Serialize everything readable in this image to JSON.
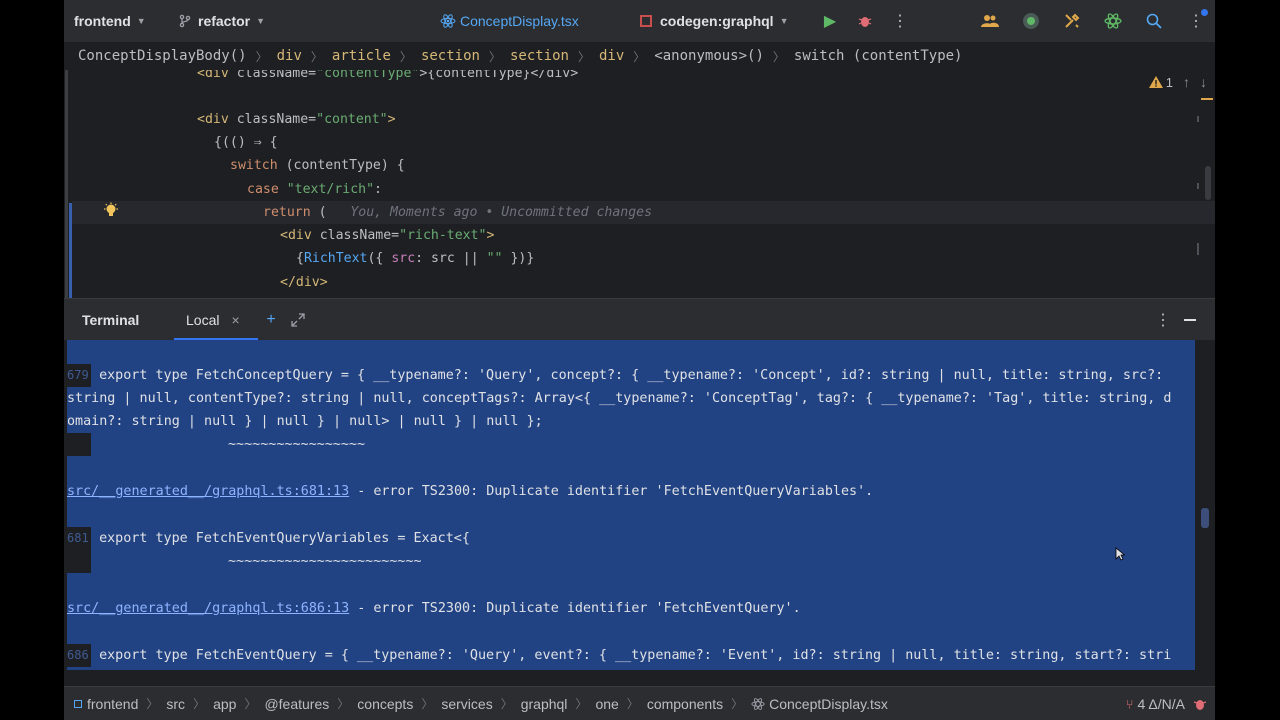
{
  "titlebar": {
    "project": "frontend",
    "branch": "refactor",
    "file_tab": "ConceptDisplay.tsx",
    "run_config": "codegen:graphql"
  },
  "breadcrumb": [
    "ConceptDisplayBody()",
    "div",
    "article",
    "section",
    "section",
    "div",
    "<anonymous>()",
    "switch (contentType)"
  ],
  "editor": {
    "line0": {
      "open": "<div ",
      "attr": "className",
      "eq": "=",
      "str": "\"contentType\"",
      "rest": ">{contentType}</div>"
    },
    "line1": {
      "open": "<div ",
      "attr": "className",
      "eq": "=",
      "str": "\"content\"",
      "close": ">"
    },
    "line2": "{(() ⇒ {",
    "line3": {
      "kw": "switch",
      "rest": " (contentType) {"
    },
    "line4": {
      "kw": "case",
      "str": " \"text/rich\"",
      "rest": ":"
    },
    "line5": {
      "kw": "return",
      "rest": " (",
      "blame": "You, Moments ago • Uncommitted changes"
    },
    "line6": {
      "open": "<div ",
      "attr": "className",
      "eq": "=",
      "str": "\"rich-text\"",
      "close": ">"
    },
    "line7": {
      "brace": "{",
      "fn": "RichText",
      "p1": "({ ",
      "param": "src",
      "p2": ": src || ",
      "str": "\"\"",
      "p3": " })}"
    },
    "line8": "</div>",
    "warnings_count": "1"
  },
  "terminal": {
    "title": "Terminal",
    "tab_label": "Local",
    "lines": {
      "l1_ln": "679",
      "l1": "export type FetchConceptQuery = { __typename?: 'Query', concept?: { __typename?: 'Concept', id?: string | null, title: string, src?: ",
      "l2": "string | null, contentType?: string | null, conceptTags?: Array<{ __typename?: 'ConceptTag', tag?: { __typename?: 'Tag', title: string, d",
      "l3": "omain?: string | null } | null } | null> | null } | null };",
      "l4": "                ~~~~~~~~~~~~~~~~~",
      "e1_link": "src/__generated__/graphql.ts:681:13",
      "e1_msg": " - error TS2300: Duplicate identifier 'FetchEventQueryVariables'.",
      "l5_ln": "681",
      "l5": "export type FetchEventQueryVariables = Exact<{",
      "l6": "                ~~~~~~~~~~~~~~~~~~~~~~~~",
      "e2_link": "src/__generated__/graphql.ts:686:13",
      "e2_msg": " - error TS2300: Duplicate identifier 'FetchEventQuery'.",
      "l7_ln": "686",
      "l7": "export type FetchEventQuery = { __typename?: 'Query', event?: { __typename?: 'Event', id?: string | null, title: string, start?: stri"
    }
  },
  "statusbar": {
    "path": [
      "frontend",
      "src",
      "app",
      "@features",
      "concepts",
      "services",
      "graphql",
      "one",
      "components",
      "ConceptDisplay.tsx"
    ],
    "git_info": "4 Δ/N/A"
  },
  "colors": {
    "accent": "#3574f0",
    "selection": "#214283",
    "run_green": "#5fb865",
    "debug_red": "#e06c75"
  }
}
